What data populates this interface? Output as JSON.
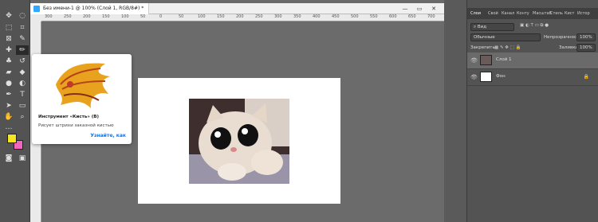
{
  "document": {
    "tab_title": "Без имени-1 @ 100% (Слой 1, RGB/8#) *",
    "win_minimize": "—",
    "win_restore": "▭",
    "win_close": "✕",
    "ruler_ticks": [
      "300",
      "250",
      "200",
      "150",
      "100",
      "50",
      "0",
      "50",
      "100",
      "150",
      "200",
      "250",
      "300",
      "350",
      "400",
      "450",
      "500",
      "550",
      "600",
      "650",
      "700",
      "750"
    ]
  },
  "tooltip": {
    "title": "Инструмент «Кисть» (B)",
    "description": "Рисует штрихи заказной кистью",
    "link": "Узнайте, как"
  },
  "panels": {
    "tabs": [
      "Слои",
      "Свой",
      "Канал",
      "Конту",
      "Масштаб",
      "Стиль",
      "Кист",
      "Истор"
    ],
    "filter_label": "Вид",
    "blend_mode": "Обычные",
    "opacity_label": "Непрозрачность:",
    "opacity_value": "100%",
    "lock_label": "Закрепить:",
    "fill_label": "Заливка:",
    "fill_value": "100%",
    "layers": [
      {
        "name": "Слой 1"
      },
      {
        "name": "Фон"
      }
    ]
  },
  "colors": {
    "foreground": "#f5e61f",
    "background": "#f266c0",
    "accent": "#1473e6"
  },
  "icons": [
    "move-icon",
    "marquee-icon",
    "lasso-icon",
    "crop-icon",
    "brush-icon",
    "eraser-icon",
    "text-icon",
    "hand-icon",
    "zoom-icon",
    "eye-icon",
    "lock-icon"
  ]
}
